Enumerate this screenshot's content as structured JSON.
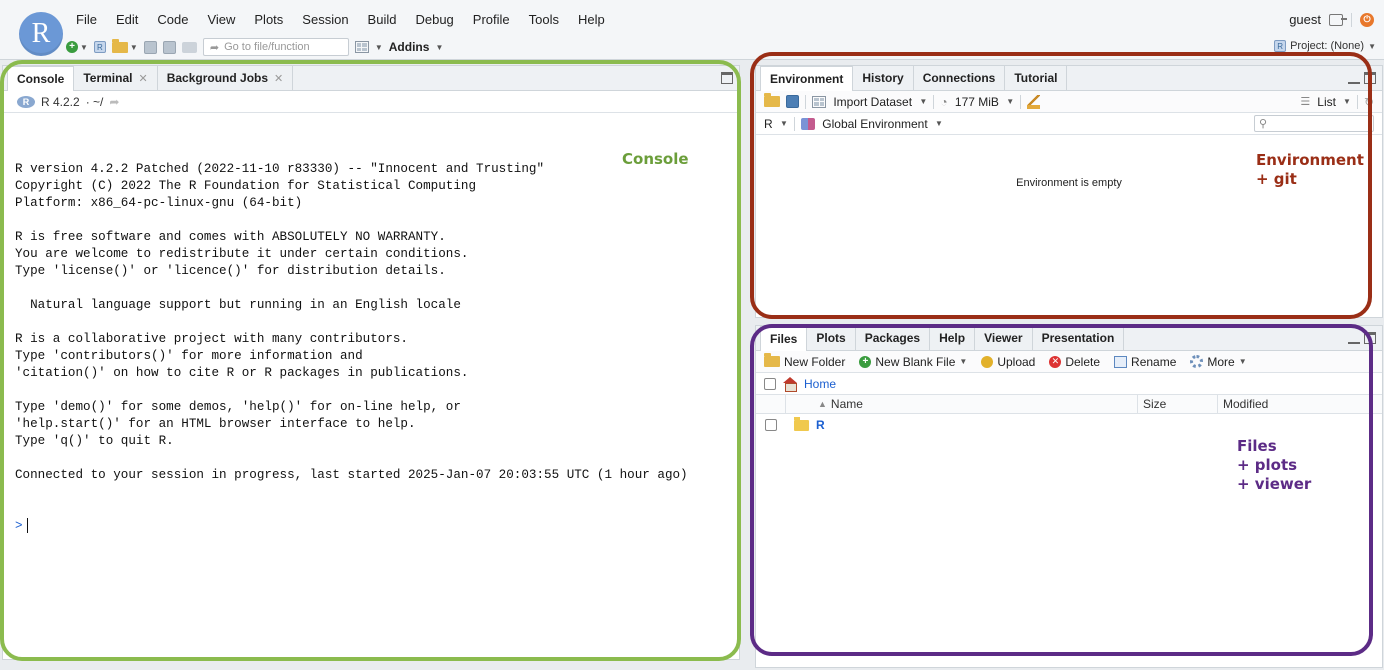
{
  "menu": [
    "File",
    "Edit",
    "Code",
    "View",
    "Plots",
    "Session",
    "Build",
    "Debug",
    "Profile",
    "Tools",
    "Help"
  ],
  "user": {
    "name": "guest"
  },
  "toolbar": {
    "goto_placeholder": "Go to file/function",
    "addins_label": "Addins",
    "project_label": "Project: (None)"
  },
  "console": {
    "tabs": [
      "Console",
      "Terminal",
      "Background Jobs"
    ],
    "version_label": "R 4.2.2",
    "path_label": "· ~/",
    "lines": [
      "R version 4.2.2 Patched (2022-11-10 r83330) -- \"Innocent and Trusting\"",
      "Copyright (C) 2022 The R Foundation for Statistical Computing",
      "Platform: x86_64-pc-linux-gnu (64-bit)",
      "",
      "R is free software and comes with ABSOLUTELY NO WARRANTY.",
      "You are welcome to redistribute it under certain conditions.",
      "Type 'license()' or 'licence()' for distribution details.",
      "",
      "  Natural language support but running in an English locale",
      "",
      "R is a collaborative project with many contributors.",
      "Type 'contributors()' for more information and",
      "'citation()' on how to cite R or R packages in publications.",
      "",
      "Type 'demo()' for some demos, 'help()' for on-line help, or",
      "'help.start()' for an HTML browser interface to help.",
      "Type 'q()' to quit R.",
      "",
      "Connected to your session in progress, last started 2025-Jan-07 20:03:55 UTC (1 hour ago)"
    ],
    "prompt": ">"
  },
  "environment": {
    "tabs": [
      "Environment",
      "History",
      "Connections",
      "Tutorial"
    ],
    "import_label": "Import Dataset",
    "memory_label": "177 MiB",
    "view_label": "List",
    "lang_label": "R",
    "scope_label": "Global Environment",
    "empty_message": "Environment is empty"
  },
  "files": {
    "tabs": [
      "Files",
      "Plots",
      "Packages",
      "Help",
      "Viewer",
      "Presentation"
    ],
    "toolbar": [
      "New Folder",
      "New Blank File",
      "Upload",
      "Delete",
      "Rename",
      "More"
    ],
    "breadcrumb": "Home",
    "columns": [
      "Name",
      "Size",
      "Modified"
    ],
    "rows": [
      {
        "name": "R",
        "size": "",
        "modified": ""
      }
    ]
  },
  "annotations": {
    "console": "Console",
    "environment": "Environment\n+ git",
    "files": "Files\n+ plots\n+ viewer"
  },
  "colors": {
    "console_frame": "#8bbb4e",
    "environment_frame": "#9a2e16",
    "files_frame": "#5c2b86"
  }
}
